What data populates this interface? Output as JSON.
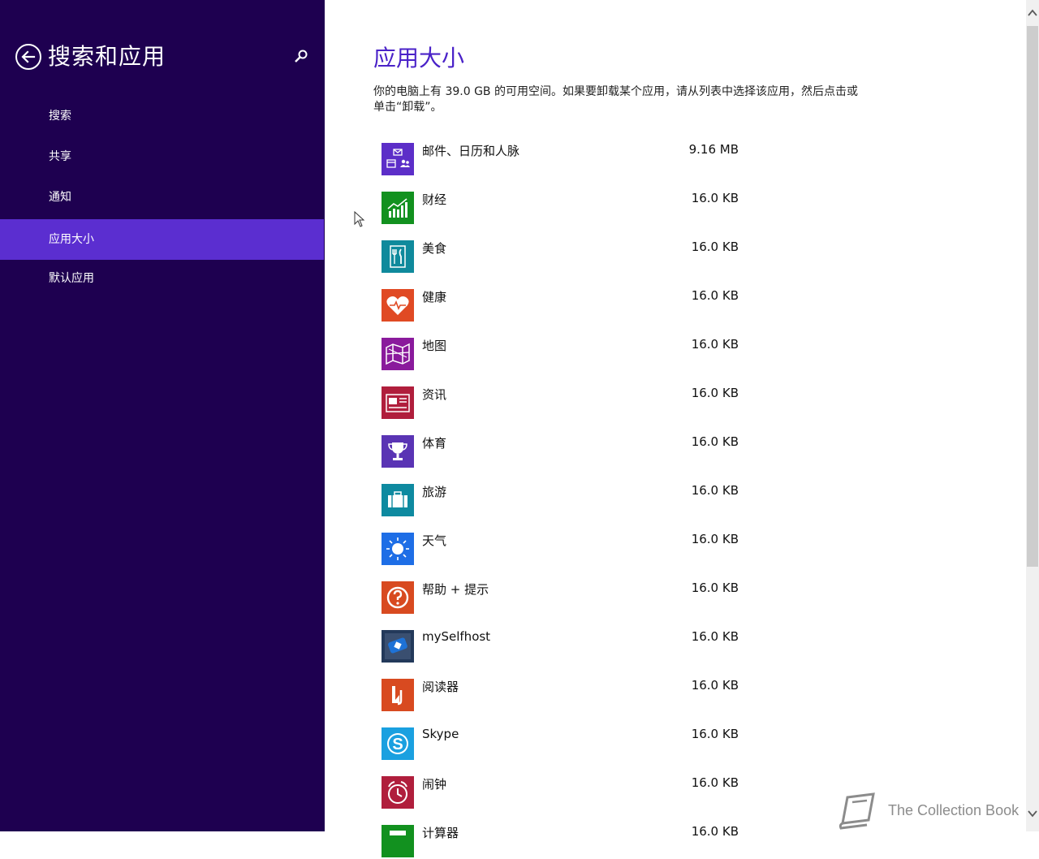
{
  "sidebar": {
    "title": "搜索和应用",
    "back_icon": "back-arrow-icon",
    "search_icon": "search-icon",
    "items": [
      {
        "label": "搜索",
        "active": false
      },
      {
        "label": "共享",
        "active": false
      },
      {
        "label": "通知",
        "active": false
      },
      {
        "label": "应用大小",
        "active": true
      },
      {
        "label": "默认应用",
        "active": false
      }
    ]
  },
  "main": {
    "title": "应用大小",
    "description": "你的电脑上有 39.0 GB 的可用空间。如果要卸载某个应用，请从列表中选择该应用，然后点击或单击“卸载”。",
    "apps": [
      {
        "name": "邮件、日历和人脉",
        "size": "9.16 MB",
        "icon": "mail-calendar-people-icon",
        "color": "#5c2ec8"
      },
      {
        "name": "财经",
        "size": "16.0 KB",
        "icon": "finance-icon",
        "color": "#12911f"
      },
      {
        "name": "美食",
        "size": "16.0 KB",
        "icon": "food-icon",
        "color": "#0f8a9c"
      },
      {
        "name": "健康",
        "size": "16.0 KB",
        "icon": "health-icon",
        "color": "#e04a24"
      },
      {
        "name": "地图",
        "size": "16.0 KB",
        "icon": "maps-icon",
        "color": "#8a1a9c"
      },
      {
        "name": "资讯",
        "size": "16.0 KB",
        "icon": "news-icon",
        "color": "#b01e3c"
      },
      {
        "name": "体育",
        "size": "16.0 KB",
        "icon": "sports-icon",
        "color": "#5a34b4"
      },
      {
        "name": "旅游",
        "size": "16.0 KB",
        "icon": "travel-icon",
        "color": "#0e8aa0"
      },
      {
        "name": "天气",
        "size": "16.0 KB",
        "icon": "weather-icon",
        "color": "#1e6ee6"
      },
      {
        "name": "帮助 + 提示",
        "size": "16.0 KB",
        "icon": "help-tips-icon",
        "color": "#d84a20"
      },
      {
        "name": "mySelfhost",
        "size": "16.0 KB",
        "icon": "myselfhost-icon",
        "color": "#23395a"
      },
      {
        "name": "阅读器",
        "size": "16.0 KB",
        "icon": "reader-icon",
        "color": "#d84a20"
      },
      {
        "name": "Skype",
        "size": "16.0 KB",
        "icon": "skype-icon",
        "color": "#1aa0e0"
      },
      {
        "name": "闹钟",
        "size": "16.0 KB",
        "icon": "alarm-icon",
        "color": "#b01e3c"
      },
      {
        "name": "计算器",
        "size": "16.0 KB",
        "icon": "calculator-icon",
        "color": "#12911f"
      }
    ]
  },
  "watermark": {
    "text": "The Collection Book",
    "icon": "book-icon"
  },
  "colors": {
    "sidebar_bg": "#1e0050",
    "active_item_bg": "#5b2ed0",
    "title_accent": "#4a22c8"
  }
}
